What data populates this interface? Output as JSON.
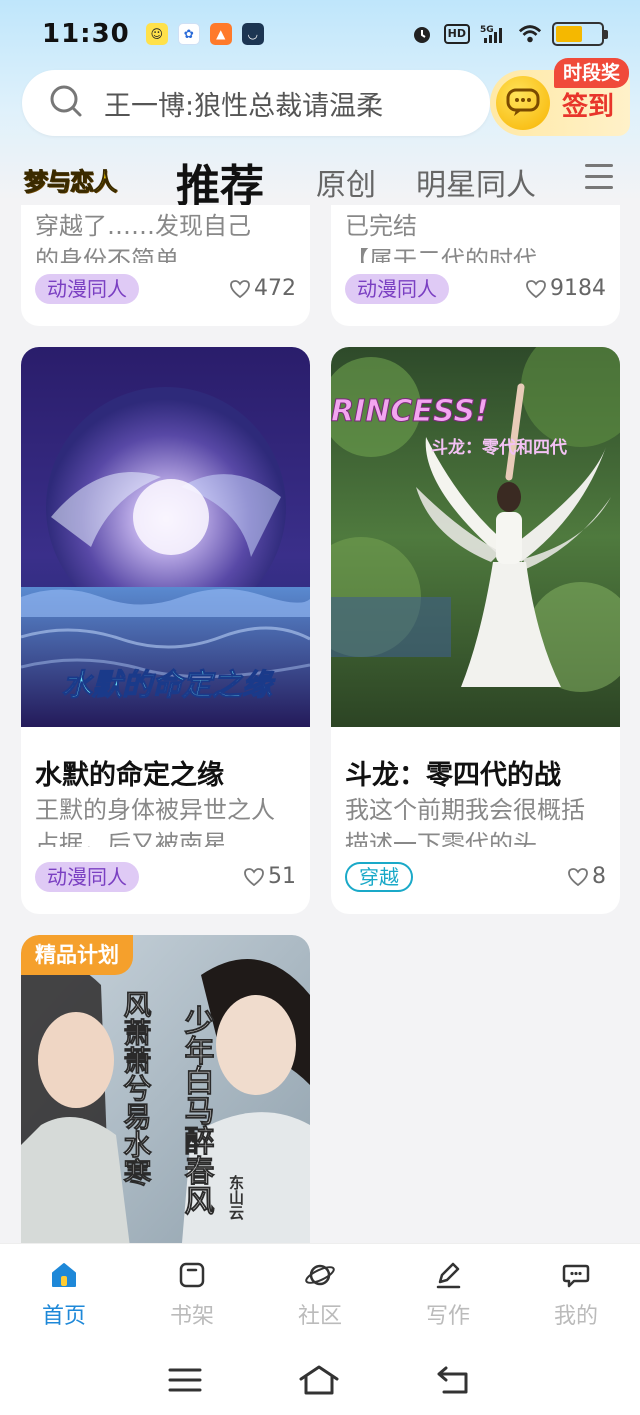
{
  "status_bar": {
    "time": "11:30",
    "hd_label": "HD",
    "net_label": "5G",
    "battery_level": 0.6
  },
  "search": {
    "placeholder": "王一博:狼性总裁请温柔"
  },
  "checkin": {
    "label": "签到",
    "badge": "时段奖"
  },
  "tabs": {
    "logo_text": "梦与恋人",
    "items": [
      "推荐",
      "原创",
      "明星同人"
    ]
  },
  "cards": [
    {
      "desc_line1": "穿越了……发现自己",
      "desc_line2": "的身份不简单……",
      "tag": "动漫同人",
      "likes": "472"
    },
    {
      "desc_line1": "已完结",
      "desc_line2": "【属于二代的时代…",
      "tag": "动漫同人",
      "likes": "9184"
    },
    {
      "cover_text": "水默的命定之缘",
      "title": "水默的命定之缘",
      "desc_line1": "王默的身体被异世之人",
      "desc_line2": "占据，后又被南星…",
      "tag": "动漫同人",
      "likes": "51"
    },
    {
      "cover_text_1": "RINCESS!",
      "cover_text_2": "斗龙：零代和四代",
      "title": "斗龙：零四代的战",
      "desc_line1": "我这个前期我会很概括",
      "desc_line2": "描述一下零代的头…",
      "tag": "穿越",
      "likes": "8"
    },
    {
      "badge": "精品计划",
      "cover_text_1": "少年白马醉春风",
      "cover_text_2": "风萧萧兮易水寒",
      "cover_text_3": "东山云"
    }
  ],
  "bottom_nav": {
    "items": [
      "首页",
      "书架",
      "社区",
      "写作",
      "我的"
    ]
  },
  "colors": {
    "accent": "#1e88d8",
    "tag_anime_bg": "#dfcaf5",
    "tag_anime_text": "#7a3fc2",
    "tag_travel": "#1aa9c8",
    "checkin_red": "#e8352b"
  }
}
